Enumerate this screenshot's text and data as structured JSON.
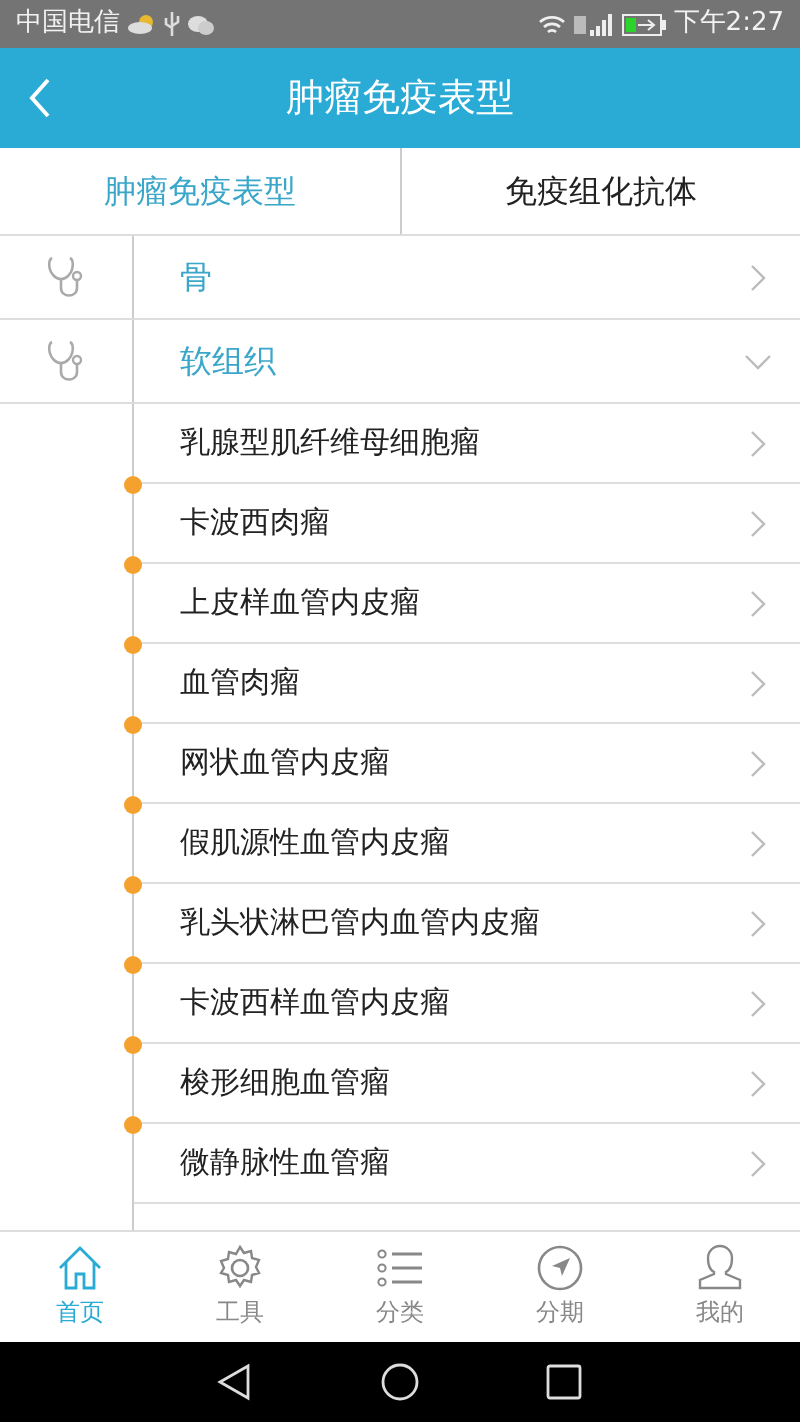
{
  "status_bar": {
    "carrier": "中国电信",
    "time": "下午2:27"
  },
  "header": {
    "title": "肿瘤免疫表型"
  },
  "tabs": [
    {
      "label": "肿瘤免疫表型",
      "selected": true
    },
    {
      "label": "免疫组化抗体",
      "selected": false
    }
  ],
  "categories": [
    {
      "label": "骨",
      "expanded": false
    },
    {
      "label": "软组织",
      "expanded": true,
      "children": [
        {
          "label": "乳腺型肌纤维母细胞瘤"
        },
        {
          "label": "卡波西肉瘤"
        },
        {
          "label": "上皮样血管内皮瘤"
        },
        {
          "label": "血管肉瘤"
        },
        {
          "label": "网状血管内皮瘤"
        },
        {
          "label": "假肌源性血管内皮瘤"
        },
        {
          "label": "乳头状淋巴管内血管内皮瘤"
        },
        {
          "label": "卡波西样血管内皮瘤"
        },
        {
          "label": "梭形细胞血管瘤"
        },
        {
          "label": "微静脉性血管瘤"
        }
      ]
    }
  ],
  "bottom_nav": [
    {
      "label": "首页",
      "selected": true
    },
    {
      "label": "工具",
      "selected": false
    },
    {
      "label": "分类",
      "selected": false
    },
    {
      "label": "分期",
      "selected": false
    },
    {
      "label": "我的",
      "selected": false
    }
  ]
}
